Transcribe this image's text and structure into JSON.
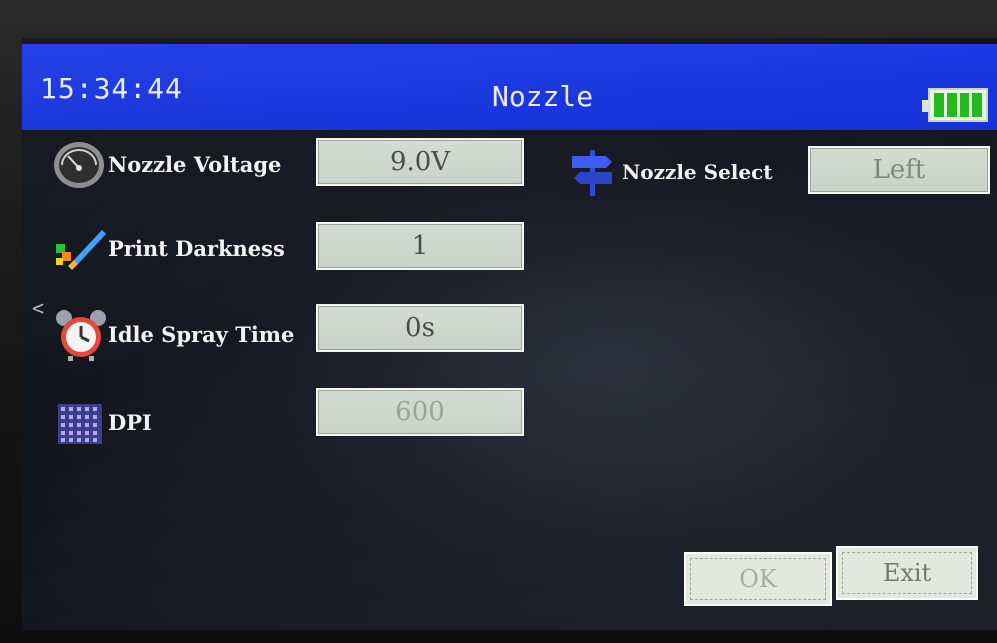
{
  "header": {
    "time": "15:34:44",
    "title": "Nozzle"
  },
  "settings": {
    "nozzle_voltage": {
      "label": "Nozzle Voltage",
      "value": "9.0V"
    },
    "print_darkness": {
      "label": "Print Darkness",
      "value": "1"
    },
    "idle_spray_time": {
      "label": "Idle Spray Time",
      "value": "0s"
    },
    "dpi": {
      "label": "DPI",
      "value": "600"
    },
    "nozzle_select": {
      "label": "Nozzle Select",
      "value": "Left"
    }
  },
  "buttons": {
    "ok": "OK",
    "exit": "Exit"
  },
  "battery": {
    "level": 1.0
  },
  "icons": [
    "gauge-icon",
    "paint-brush-icon",
    "alarm-clock-icon",
    "dot-grid-icon",
    "signpost-icon",
    "battery-icon",
    "chevron-left-icon"
  ],
  "colors": {
    "header_blue": "#1532d8",
    "field_bg": "#cfd8cf",
    "battery_green": "#27b820"
  }
}
